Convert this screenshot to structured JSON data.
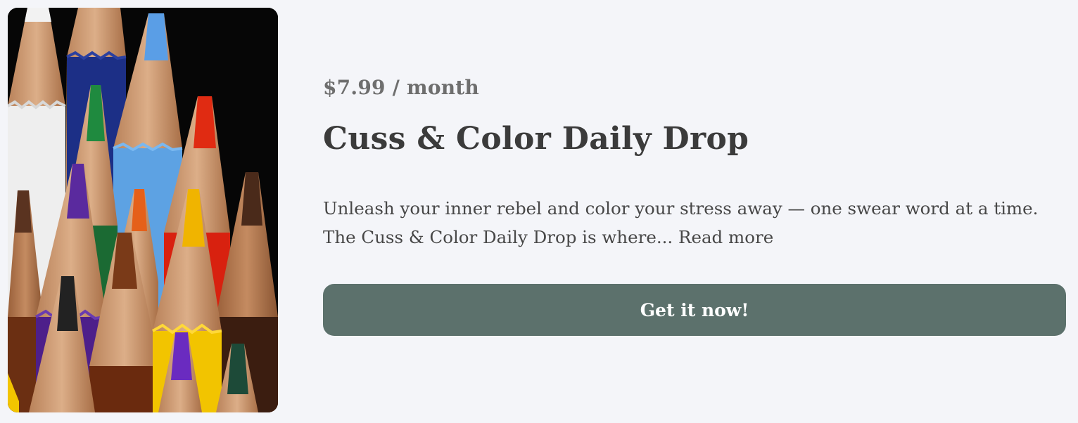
{
  "product": {
    "image_alt": "colored-pencils-photo",
    "price": "$7.99 / month",
    "title": "Cuss & Color Daily Drop",
    "description": "Unleash your inner rebel and color your stress away — one swear word at a time. The Cuss & Color Daily Drop is where...",
    "read_more_label": "Read more",
    "cta_label": "Get it now!"
  },
  "colors": {
    "background": "#f4f5f9",
    "button": "#5c716c",
    "title_text": "#3b3b3b",
    "price_text": "#6e6e6e"
  }
}
